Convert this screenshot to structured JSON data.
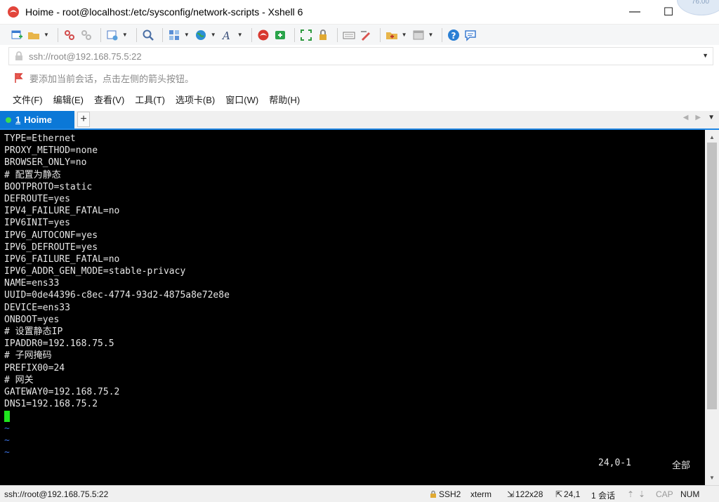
{
  "window": {
    "title": "Hoime - root@localhost:/etc/sysconfig/network-scripts - Xshell 6",
    "minimize": "—",
    "maximize": "☐",
    "close": "✕",
    "corner_badge": "76.00"
  },
  "address": {
    "value": "ssh://root@192.168.75.5:22"
  },
  "hint": {
    "text": "要添加当前会话，点击左侧的箭头按钮。"
  },
  "menu": {
    "items": [
      "文件(F)",
      "编辑(E)",
      "查看(V)",
      "工具(T)",
      "选项卡(B)",
      "窗口(W)",
      "帮助(H)"
    ]
  },
  "tabs": {
    "active_number": "1",
    "active_label": "Hoime",
    "add_label": "+"
  },
  "terminal": {
    "lines": [
      "TYPE=Ethernet",
      "PROXY_METHOD=none",
      "BROWSER_ONLY=no",
      "# 配置为静态",
      "BOOTPROTO=static",
      "DEFROUTE=yes",
      "IPV4_FAILURE_FATAL=no",
      "IPV6INIT=yes",
      "IPV6_AUTOCONF=yes",
      "IPV6_DEFROUTE=yes",
      "IPV6_FAILURE_FATAL=no",
      "IPV6_ADDR_GEN_MODE=stable-privacy",
      "NAME=ens33",
      "UUID=0de44396-c8ec-4774-93d2-4875a8e72e8e",
      "DEVICE=ens33",
      "ONBOOT=yes",
      "# 设置静态IP",
      "IPADDR0=192.168.75.5",
      "# 子网掩码",
      "PREFIX00=24",
      "# 网关",
      "GATEWAY0=192.168.75.2",
      "DNS1=192.168.75.2"
    ],
    "tildes": [
      "~",
      "~",
      "~"
    ],
    "vim_position": "24,0-1",
    "vim_scope": "全部"
  },
  "status": {
    "connection": "ssh://root@192.168.75.5:22",
    "protocol": "SSH2",
    "term_type": "xterm",
    "size": "122x28",
    "cursor": "24,1",
    "sessions": "1 会话",
    "cap": "CAP",
    "num": "NUM"
  },
  "colors": {
    "tab_active": "#0b78d7",
    "terminal_bg": "#000000",
    "terminal_fg": "#e6e6e6",
    "cursor": "#1ee51e",
    "tilde": "#3a70e0"
  }
}
